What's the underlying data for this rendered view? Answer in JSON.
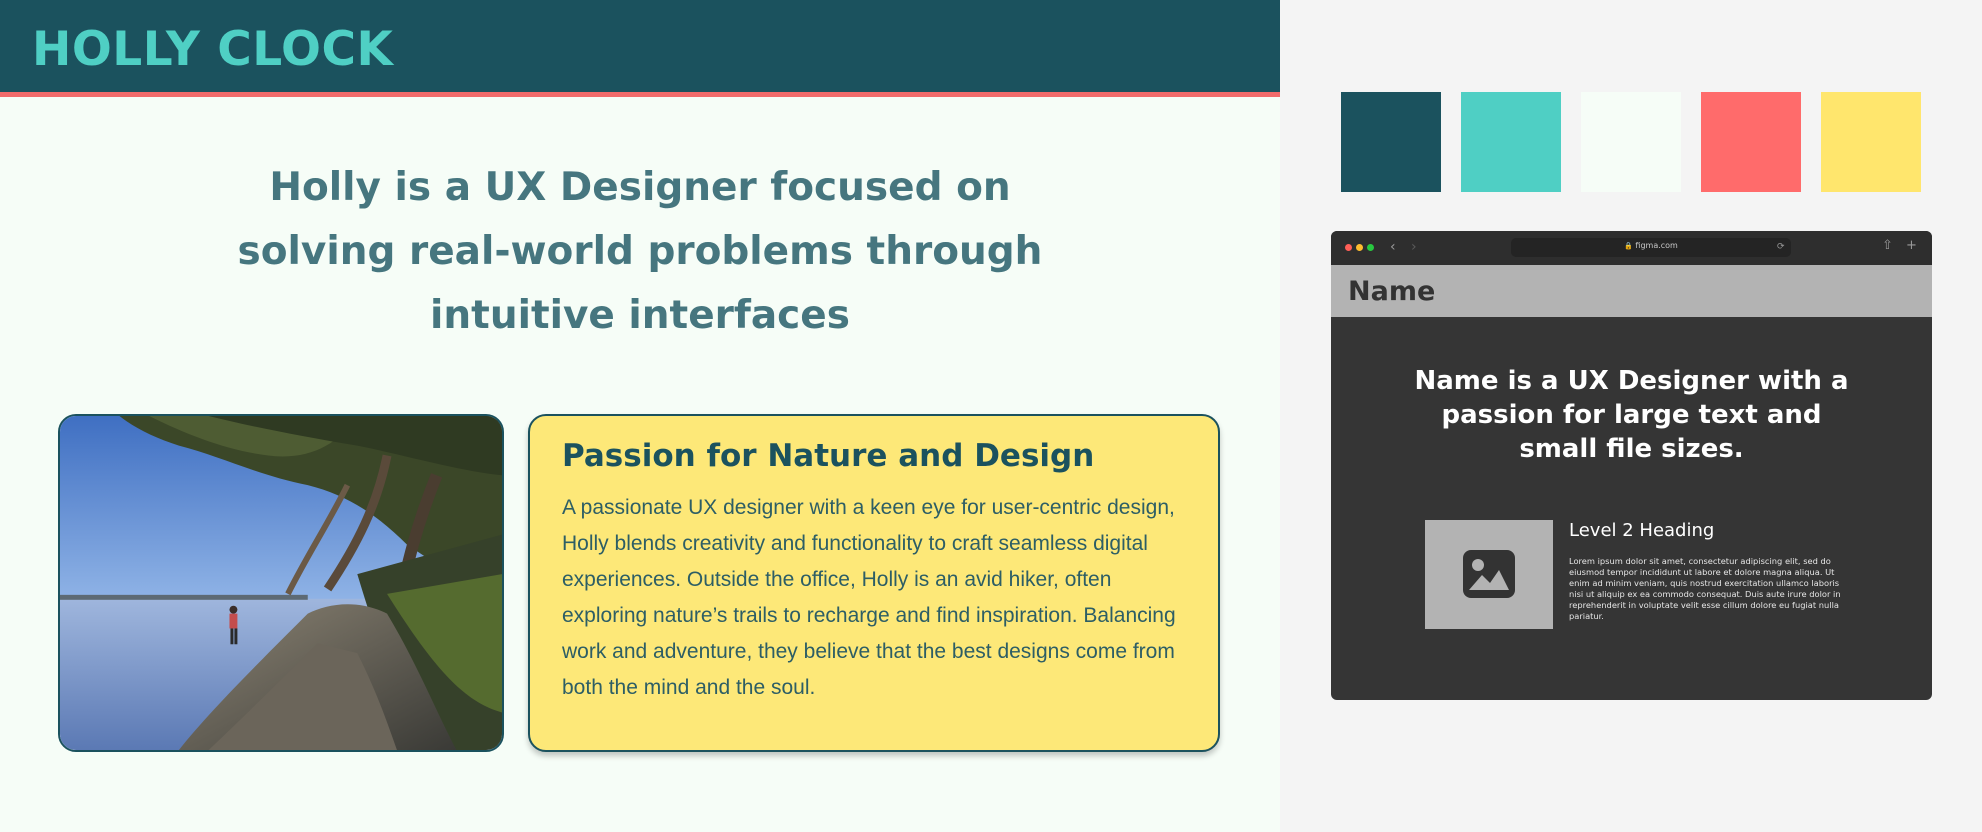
{
  "site": {
    "logo": "HOLLY CLOCK",
    "hero": "Holly is a UX Designer focused on solving real-world problems through intuitive interfaces",
    "photo_alt": "Person standing at the edge of a rocky lakeshore under trees",
    "card": {
      "title": "Passion for Nature and Design",
      "body": "A passionate UX designer with a keen eye for user-centric design, Holly blends creativity and functionality to craft seamless digital experiences. Outside the office, Holly is an avid hiker, often exploring nature’s trails to recharge and find inspiration. Balancing work and adventure, they believe that the best designs come from both the mind and the soul."
    }
  },
  "palette": [
    "#1b525e",
    "#4fcfc4",
    "#f6fdf7",
    "#ff6b6b",
    "#ffe66d"
  ],
  "wireframe": {
    "url": "figma.com",
    "name": "Name",
    "hero": "Name is a UX Designer with a passion for large text and small file sizes.",
    "heading": "Level 2 Heading",
    "lorem": "Lorem ipsum dolor sit amet, consectetur adipiscing elit, sed do eiusmod tempor incididunt ut labore et dolore magna aliqua. Ut enim ad minim veniam, quis nostrud exercitation ullamco laboris nisi ut aliquip ex ea commodo consequat. Duis aute irure dolor in reprehenderit in voluptate velit esse cillum dolore eu fugiat nulla pariatur."
  },
  "icons": {
    "lock": "lock-icon",
    "back": "chevron-left-icon",
    "forward": "chevron-right-icon",
    "reload": "reload-icon",
    "share": "share-icon",
    "new_tab": "plus-icon",
    "image_placeholder": "image-icon"
  }
}
